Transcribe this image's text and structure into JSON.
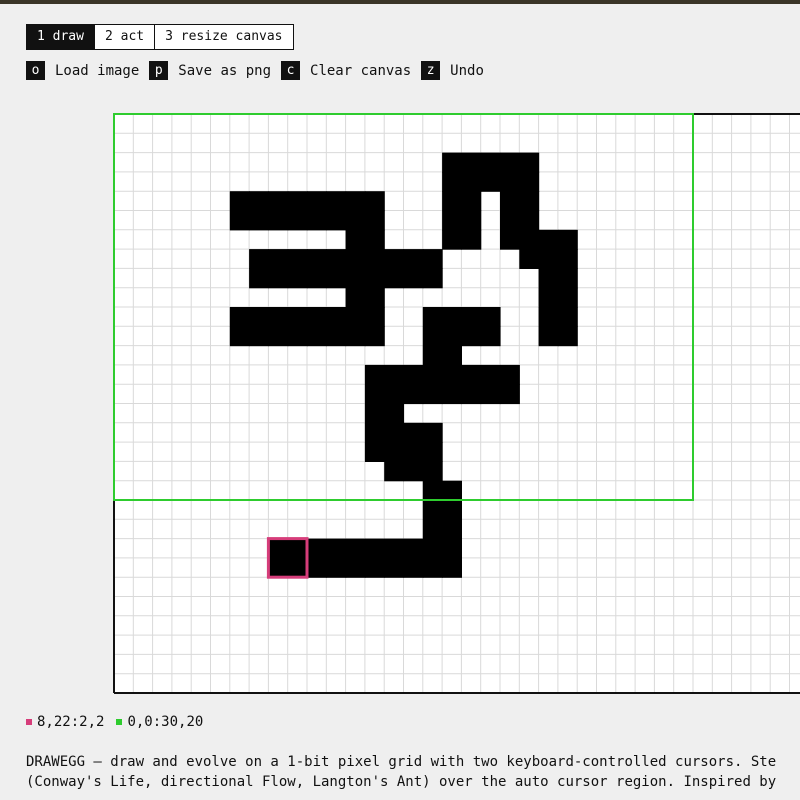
{
  "tabs": [
    {
      "label": "1 draw",
      "active": true
    },
    {
      "label": "2 act",
      "active": false
    },
    {
      "label": "3 resize canvas",
      "active": false
    }
  ],
  "actions": [
    {
      "key": "o",
      "label": "Load image"
    },
    {
      "key": "p",
      "label": "Save as png"
    },
    {
      "key": "c",
      "label": "Clear canvas"
    },
    {
      "key": "z",
      "label": "Undo"
    }
  ],
  "canvas": {
    "cols": 36,
    "rows": 30,
    "filled_cells": [
      [
        17,
        2
      ],
      [
        18,
        2
      ],
      [
        19,
        2
      ],
      [
        20,
        2
      ],
      [
        21,
        2
      ],
      [
        17,
        3
      ],
      [
        18,
        3
      ],
      [
        19,
        3
      ],
      [
        20,
        3
      ],
      [
        21,
        3
      ],
      [
        6,
        4
      ],
      [
        7,
        4
      ],
      [
        8,
        4
      ],
      [
        9,
        4
      ],
      [
        10,
        4
      ],
      [
        11,
        4
      ],
      [
        12,
        4
      ],
      [
        13,
        4
      ],
      [
        17,
        4
      ],
      [
        18,
        4
      ],
      [
        20,
        4
      ],
      [
        21,
        4
      ],
      [
        6,
        5
      ],
      [
        7,
        5
      ],
      [
        8,
        5
      ],
      [
        9,
        5
      ],
      [
        10,
        5
      ],
      [
        11,
        5
      ],
      [
        12,
        5
      ],
      [
        13,
        5
      ],
      [
        17,
        5
      ],
      [
        18,
        5
      ],
      [
        20,
        5
      ],
      [
        21,
        5
      ],
      [
        12,
        6
      ],
      [
        13,
        6
      ],
      [
        17,
        6
      ],
      [
        18,
        6
      ],
      [
        20,
        6
      ],
      [
        21,
        6
      ],
      [
        22,
        6
      ],
      [
        23,
        6
      ],
      [
        7,
        7
      ],
      [
        8,
        7
      ],
      [
        9,
        7
      ],
      [
        10,
        7
      ],
      [
        11,
        7
      ],
      [
        12,
        7
      ],
      [
        13,
        7
      ],
      [
        14,
        7
      ],
      [
        15,
        7
      ],
      [
        16,
        7
      ],
      [
        21,
        7
      ],
      [
        22,
        7
      ],
      [
        23,
        7
      ],
      [
        7,
        8
      ],
      [
        8,
        8
      ],
      [
        9,
        8
      ],
      [
        10,
        8
      ],
      [
        11,
        8
      ],
      [
        12,
        8
      ],
      [
        13,
        8
      ],
      [
        14,
        8
      ],
      [
        15,
        8
      ],
      [
        16,
        8
      ],
      [
        22,
        8
      ],
      [
        23,
        8
      ],
      [
        12,
        9
      ],
      [
        13,
        9
      ],
      [
        22,
        9
      ],
      [
        23,
        9
      ],
      [
        6,
        10
      ],
      [
        7,
        10
      ],
      [
        8,
        10
      ],
      [
        9,
        10
      ],
      [
        10,
        10
      ],
      [
        11,
        10
      ],
      [
        12,
        10
      ],
      [
        13,
        10
      ],
      [
        16,
        10
      ],
      [
        17,
        10
      ],
      [
        18,
        10
      ],
      [
        19,
        10
      ],
      [
        22,
        10
      ],
      [
        23,
        10
      ],
      [
        6,
        11
      ],
      [
        7,
        11
      ],
      [
        8,
        11
      ],
      [
        9,
        11
      ],
      [
        10,
        11
      ],
      [
        11,
        11
      ],
      [
        12,
        11
      ],
      [
        13,
        11
      ],
      [
        16,
        11
      ],
      [
        17,
        11
      ],
      [
        18,
        11
      ],
      [
        19,
        11
      ],
      [
        22,
        11
      ],
      [
        23,
        11
      ],
      [
        16,
        12
      ],
      [
        17,
        12
      ],
      [
        13,
        13
      ],
      [
        14,
        13
      ],
      [
        15,
        13
      ],
      [
        16,
        13
      ],
      [
        17,
        13
      ],
      [
        18,
        13
      ],
      [
        19,
        13
      ],
      [
        20,
        13
      ],
      [
        13,
        14
      ],
      [
        14,
        14
      ],
      [
        15,
        14
      ],
      [
        16,
        14
      ],
      [
        17,
        14
      ],
      [
        18,
        14
      ],
      [
        19,
        14
      ],
      [
        20,
        14
      ],
      [
        13,
        15
      ],
      [
        14,
        15
      ],
      [
        13,
        16
      ],
      [
        14,
        16
      ],
      [
        15,
        16
      ],
      [
        16,
        16
      ],
      [
        13,
        17
      ],
      [
        14,
        17
      ],
      [
        15,
        17
      ],
      [
        16,
        17
      ],
      [
        14,
        18
      ],
      [
        15,
        18
      ],
      [
        16,
        18
      ],
      [
        16,
        19
      ],
      [
        17,
        19
      ],
      [
        16,
        20
      ],
      [
        17,
        20
      ],
      [
        16,
        21
      ],
      [
        17,
        21
      ],
      [
        8,
        22
      ],
      [
        9,
        22
      ],
      [
        10,
        22
      ],
      [
        11,
        22
      ],
      [
        12,
        22
      ],
      [
        13,
        22
      ],
      [
        14,
        22
      ],
      [
        15,
        22
      ],
      [
        16,
        22
      ],
      [
        17,
        22
      ],
      [
        8,
        23
      ],
      [
        9,
        23
      ],
      [
        10,
        23
      ],
      [
        11,
        23
      ],
      [
        12,
        23
      ],
      [
        13,
        23
      ],
      [
        14,
        23
      ],
      [
        15,
        23
      ],
      [
        16,
        23
      ],
      [
        17,
        23
      ]
    ],
    "auto_cursor": {
      "col": 0,
      "row": 0,
      "width": 30,
      "height": 20
    },
    "manual_cursor": {
      "col": 8,
      "row": 22,
      "width": 2,
      "height": 2
    },
    "colors": {
      "pixel": "#000000",
      "grid_line": "#d9d9d9",
      "background": "#ffffff",
      "border": "#111111",
      "auto_cursor": "#2ecc2e",
      "manual_cursor": "#d63d7a"
    }
  },
  "status": {
    "manual": {
      "text": "8,22:2,2",
      "color": "#d63d7a"
    },
    "auto": {
      "text": "0,0:30,20",
      "color": "#2ecc2e"
    }
  },
  "description": [
    "DRAWEGG — draw and evolve on a 1-bit pixel grid with two keyboard-controlled cursors. Ste",
    "(Conway's Life, directional Flow, Langton's Ant) over the auto cursor region. Inspired by"
  ]
}
